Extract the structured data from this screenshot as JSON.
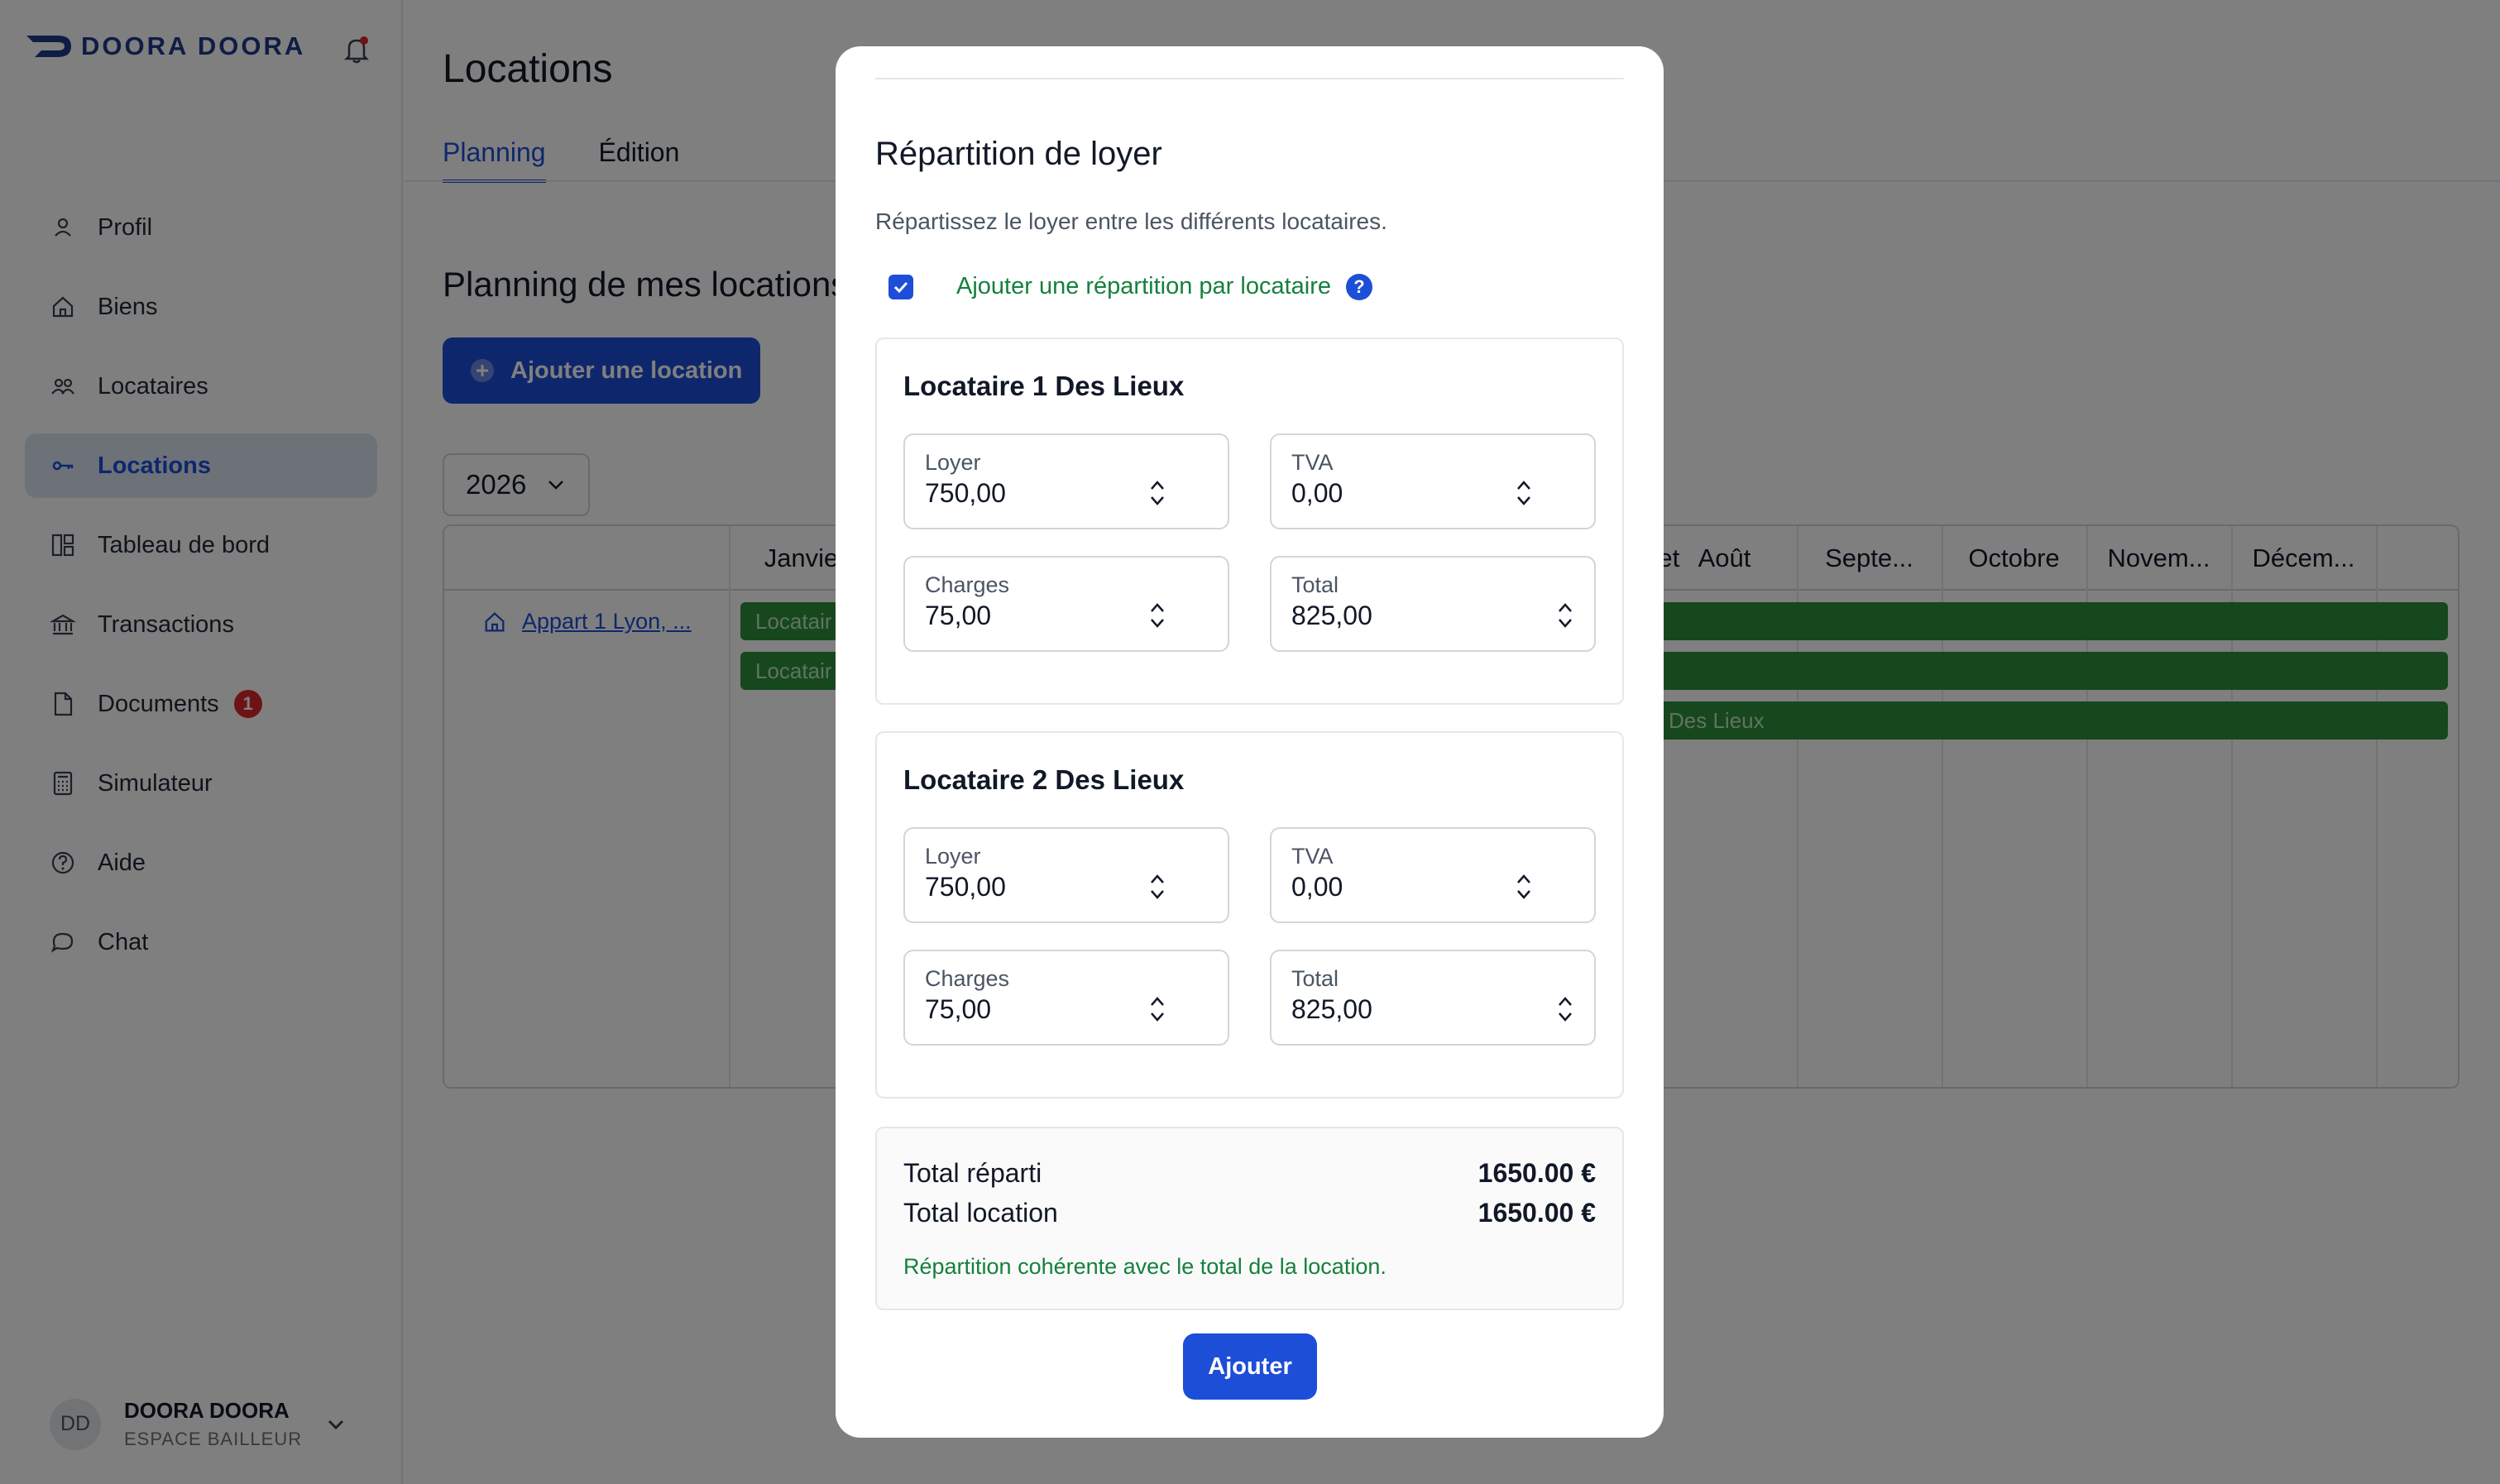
{
  "app": {
    "brand": "DOORA DOORA"
  },
  "sidebar": {
    "items": [
      {
        "label": "Profil",
        "icon": "user-icon"
      },
      {
        "label": "Biens",
        "icon": "home-icon"
      },
      {
        "label": "Locataires",
        "icon": "users-icon"
      },
      {
        "label": "Locations",
        "icon": "key-icon",
        "active": true
      },
      {
        "label": "Tableau de bord",
        "icon": "dashboard-icon"
      },
      {
        "label": "Transactions",
        "icon": "bank-icon"
      },
      {
        "label": "Documents",
        "icon": "document-icon",
        "badge": "1"
      },
      {
        "label": "Simulateur",
        "icon": "calculator-icon"
      },
      {
        "label": "Aide",
        "icon": "help-circle-icon"
      },
      {
        "label": "Chat",
        "icon": "chat-icon"
      }
    ],
    "user": {
      "initials": "DD",
      "name": "DOORA DOORA",
      "role": "ESPACE BAILLEUR"
    }
  },
  "main": {
    "title": "Locations",
    "tabs": [
      {
        "label": "Planning",
        "active": true
      },
      {
        "label": "Édition"
      }
    ],
    "section_title": "Planning de mes locations",
    "add_button": "Ajouter une location",
    "year": "2026",
    "months_visible": [
      "Janvie",
      "illet",
      "Août",
      "Septe...",
      "Octobre",
      "Novem...",
      "Décem..."
    ],
    "property_link": "Appart 1 Lyon, ...",
    "bars": [
      {
        "left_label": "Locatair",
        "right_label": ""
      },
      {
        "left_label": "Locatair",
        "right_label": ""
      },
      {
        "left_label": "",
        "right_label": "Des Lieux"
      }
    ]
  },
  "modal": {
    "title": "Répartition de loyer",
    "subtitle": "Répartissez le loyer entre les différents locataires.",
    "checkbox_label": "Ajouter une répartition par locataire",
    "checkbox_checked": true,
    "tenants": [
      {
        "name": "Locataire 1 Des Lieux",
        "loyer_label": "Loyer",
        "loyer": "750,00",
        "tva_label": "TVA",
        "tva": "0,00",
        "charges_label": "Charges",
        "charges": "75,00",
        "total_label": "Total",
        "total": "825,00"
      },
      {
        "name": "Locataire 2 Des Lieux",
        "loyer_label": "Loyer",
        "loyer": "750,00",
        "tva_label": "TVA",
        "tva": "0,00",
        "charges_label": "Charges",
        "charges": "75,00",
        "total_label": "Total",
        "total": "825,00"
      }
    ],
    "totals": {
      "reparti_label": "Total réparti",
      "reparti": "1650.00 €",
      "location_label": "Total location",
      "location": "1650.00 €",
      "status": "Répartition cohérente avec le total de la location."
    },
    "submit": "Ajouter"
  },
  "colors": {
    "accent": "#1d4ed8",
    "brand": "#1e3a8a",
    "success": "#15803d",
    "bar_green": "#2f8f3a",
    "badge_red": "#dc2626"
  }
}
